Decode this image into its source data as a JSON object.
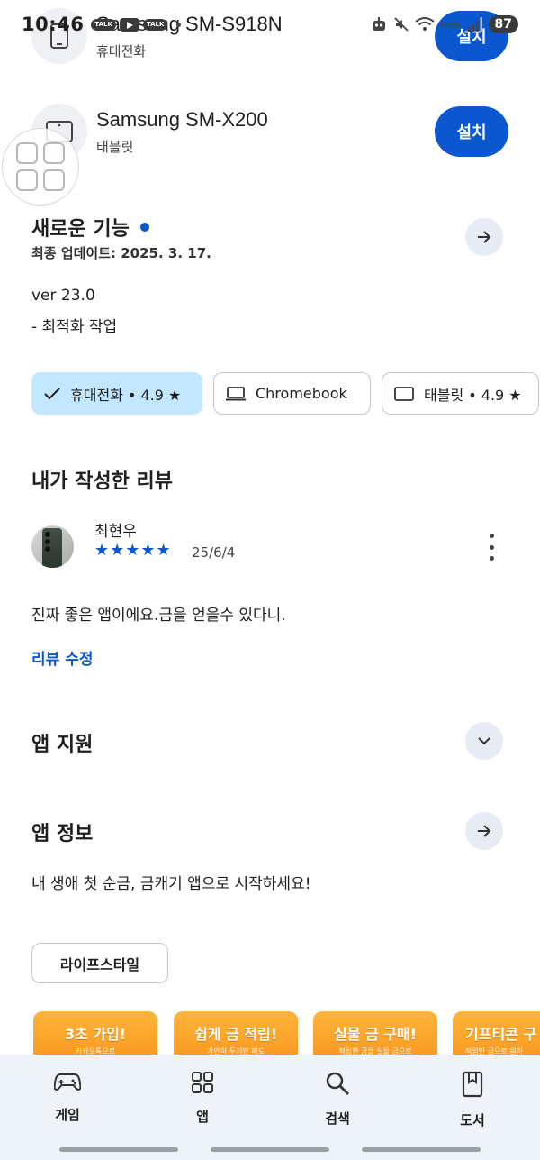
{
  "status_bar": {
    "time": "10:46",
    "talk_label": "TALK",
    "battery": "87"
  },
  "devices": [
    {
      "name": "Samsung SM-S918N",
      "type": "휴대전화",
      "install_label": "설치"
    },
    {
      "name": "Samsung SM-X200",
      "type": "태블릿",
      "install_label": "설치"
    }
  ],
  "whats_new": {
    "title": "새로운 기능",
    "last_updated": "최종 업데이트: 2025. 3. 17.",
    "version": "ver 23.0",
    "notes": "- 최적화 작업"
  },
  "device_chips": [
    {
      "label": "휴대전화 • 4.9 ★",
      "selected": true
    },
    {
      "label": "Chromebook",
      "selected": false
    },
    {
      "label": "태블릿 • 4.9 ★",
      "selected": false
    }
  ],
  "my_review": {
    "title": "내가 작성한 리뷰",
    "reviewer": "최현우",
    "stars": "★★★★★",
    "rating": 5,
    "date": "25/6/4",
    "text": "진짜 좋은 앱이에요.금을 얻을수 있다니.",
    "edit_label": "리뷰 수정"
  },
  "app_support": {
    "title": "앱 지원"
  },
  "app_info": {
    "title": "앱 정보",
    "description": "내 생애 첫 순금, 금캐기 앱으로 시작하세요!",
    "category": "라이프스타일"
  },
  "promos": [
    {
      "title": "3초 가입!",
      "subtitle": "카카오톡으로"
    },
    {
      "title": "쉽게 금 적립!",
      "subtitle": "가만히 두기만 해도"
    },
    {
      "title": "실물 금 구매!",
      "subtitle": "적립한 금을 실물 금으로"
    },
    {
      "title": "기프티콘 구",
      "subtitle": "적립한 금으로 원하"
    }
  ],
  "bottom_nav": [
    {
      "label": "게임",
      "icon": "gamepad-icon"
    },
    {
      "label": "앱",
      "icon": "apps-grid-icon"
    },
    {
      "label": "검색",
      "icon": "search-icon"
    },
    {
      "label": "도서",
      "icon": "book-icon"
    }
  ],
  "colors": {
    "accent": "#0b57d0",
    "chip_selected": "#c2e7ff",
    "nav_background": "#eef2f9",
    "promo_orange": "#f7941d"
  }
}
